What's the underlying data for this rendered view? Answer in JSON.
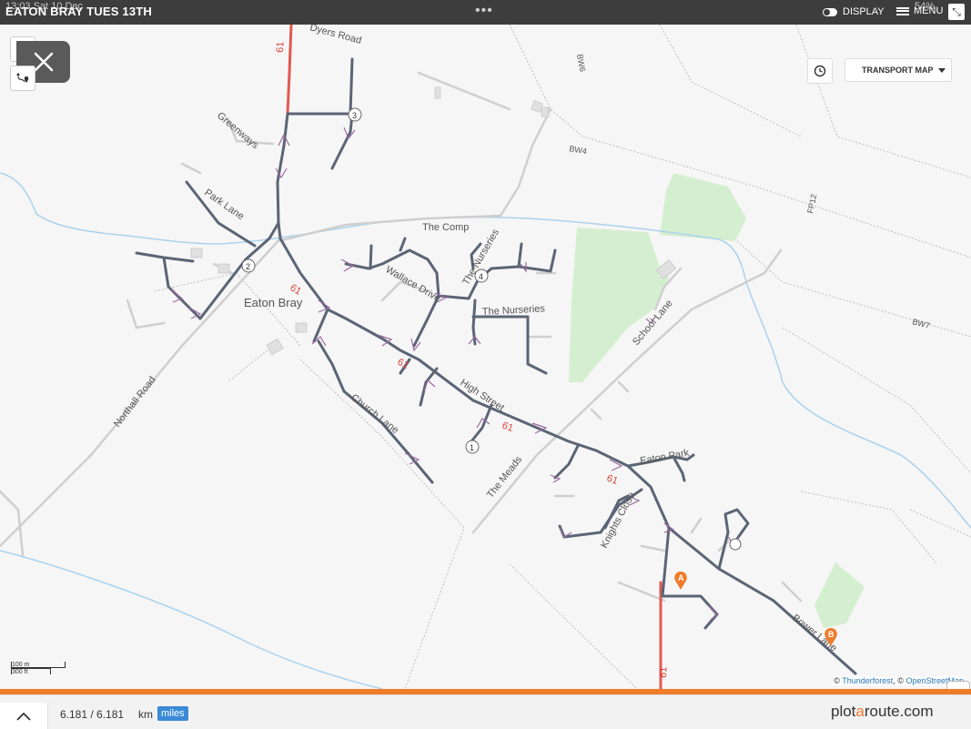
{
  "header": {
    "status_time": "13:03  Sat 10 Dec",
    "title": "EATON BRAY TUES 13TH",
    "more": "•••",
    "display_label": "DISPLAY",
    "menu_label": "MENU",
    "battery": "54%",
    "expand_icon": "⤡"
  },
  "map_controls": {
    "close_icon": "close-icon",
    "layer_select": "TRANSPORT MAP"
  },
  "map": {
    "places": {
      "village": "Eaton Bray"
    },
    "roads": {
      "dyers_road": "Dyers Road",
      "greenways": "Greenways",
      "park_lane": "Park Lane",
      "northall_road": "Northall Road",
      "the_comp": "The Comp",
      "wallace_drive": "Wallace Drive",
      "the_nurseries_1": "The Nurseries",
      "the_nurseries_2": "The Nurseries",
      "church_lane": "Church Lane",
      "high_street": "High Street",
      "school_lane": "School Lane",
      "the_meads": "The Meads",
      "eaton_park": "Eaton Park",
      "knights_close": "Knights Close",
      "bower_lane": "Bower Lane"
    },
    "paths": {
      "bw6": "BW6",
      "bw4": "BW4",
      "fp12": "FP12",
      "bw7": "BW7"
    },
    "route_numbers": {
      "r1": "61",
      "r2": "61",
      "r3": "61",
      "r4": "61",
      "r5": "61",
      "r6": "61"
    },
    "waypoints": {
      "w1": "1",
      "w2": "2",
      "w3": "3",
      "w4": "4"
    },
    "markers": {
      "start": "A",
      "end": "B"
    },
    "colors": {
      "route": "#5b6575",
      "main_road": "#e05a52",
      "water": "#a9d2ee",
      "park": "#d4efcf",
      "marker": "#f07b2b"
    }
  },
  "scale": {
    "metric": "100 m",
    "imperial": "300 ft"
  },
  "attribution": {
    "copyright": "©",
    "provider": "Thunderforest",
    "separator": ", ©",
    "osm": "OpenStreetMap"
  },
  "footer": {
    "distance": "6.181 / 6.181",
    "unit_km": "km",
    "unit_miles": "miles",
    "brand_a": "plot",
    "brand_b": "a",
    "brand_c": "route.com"
  }
}
